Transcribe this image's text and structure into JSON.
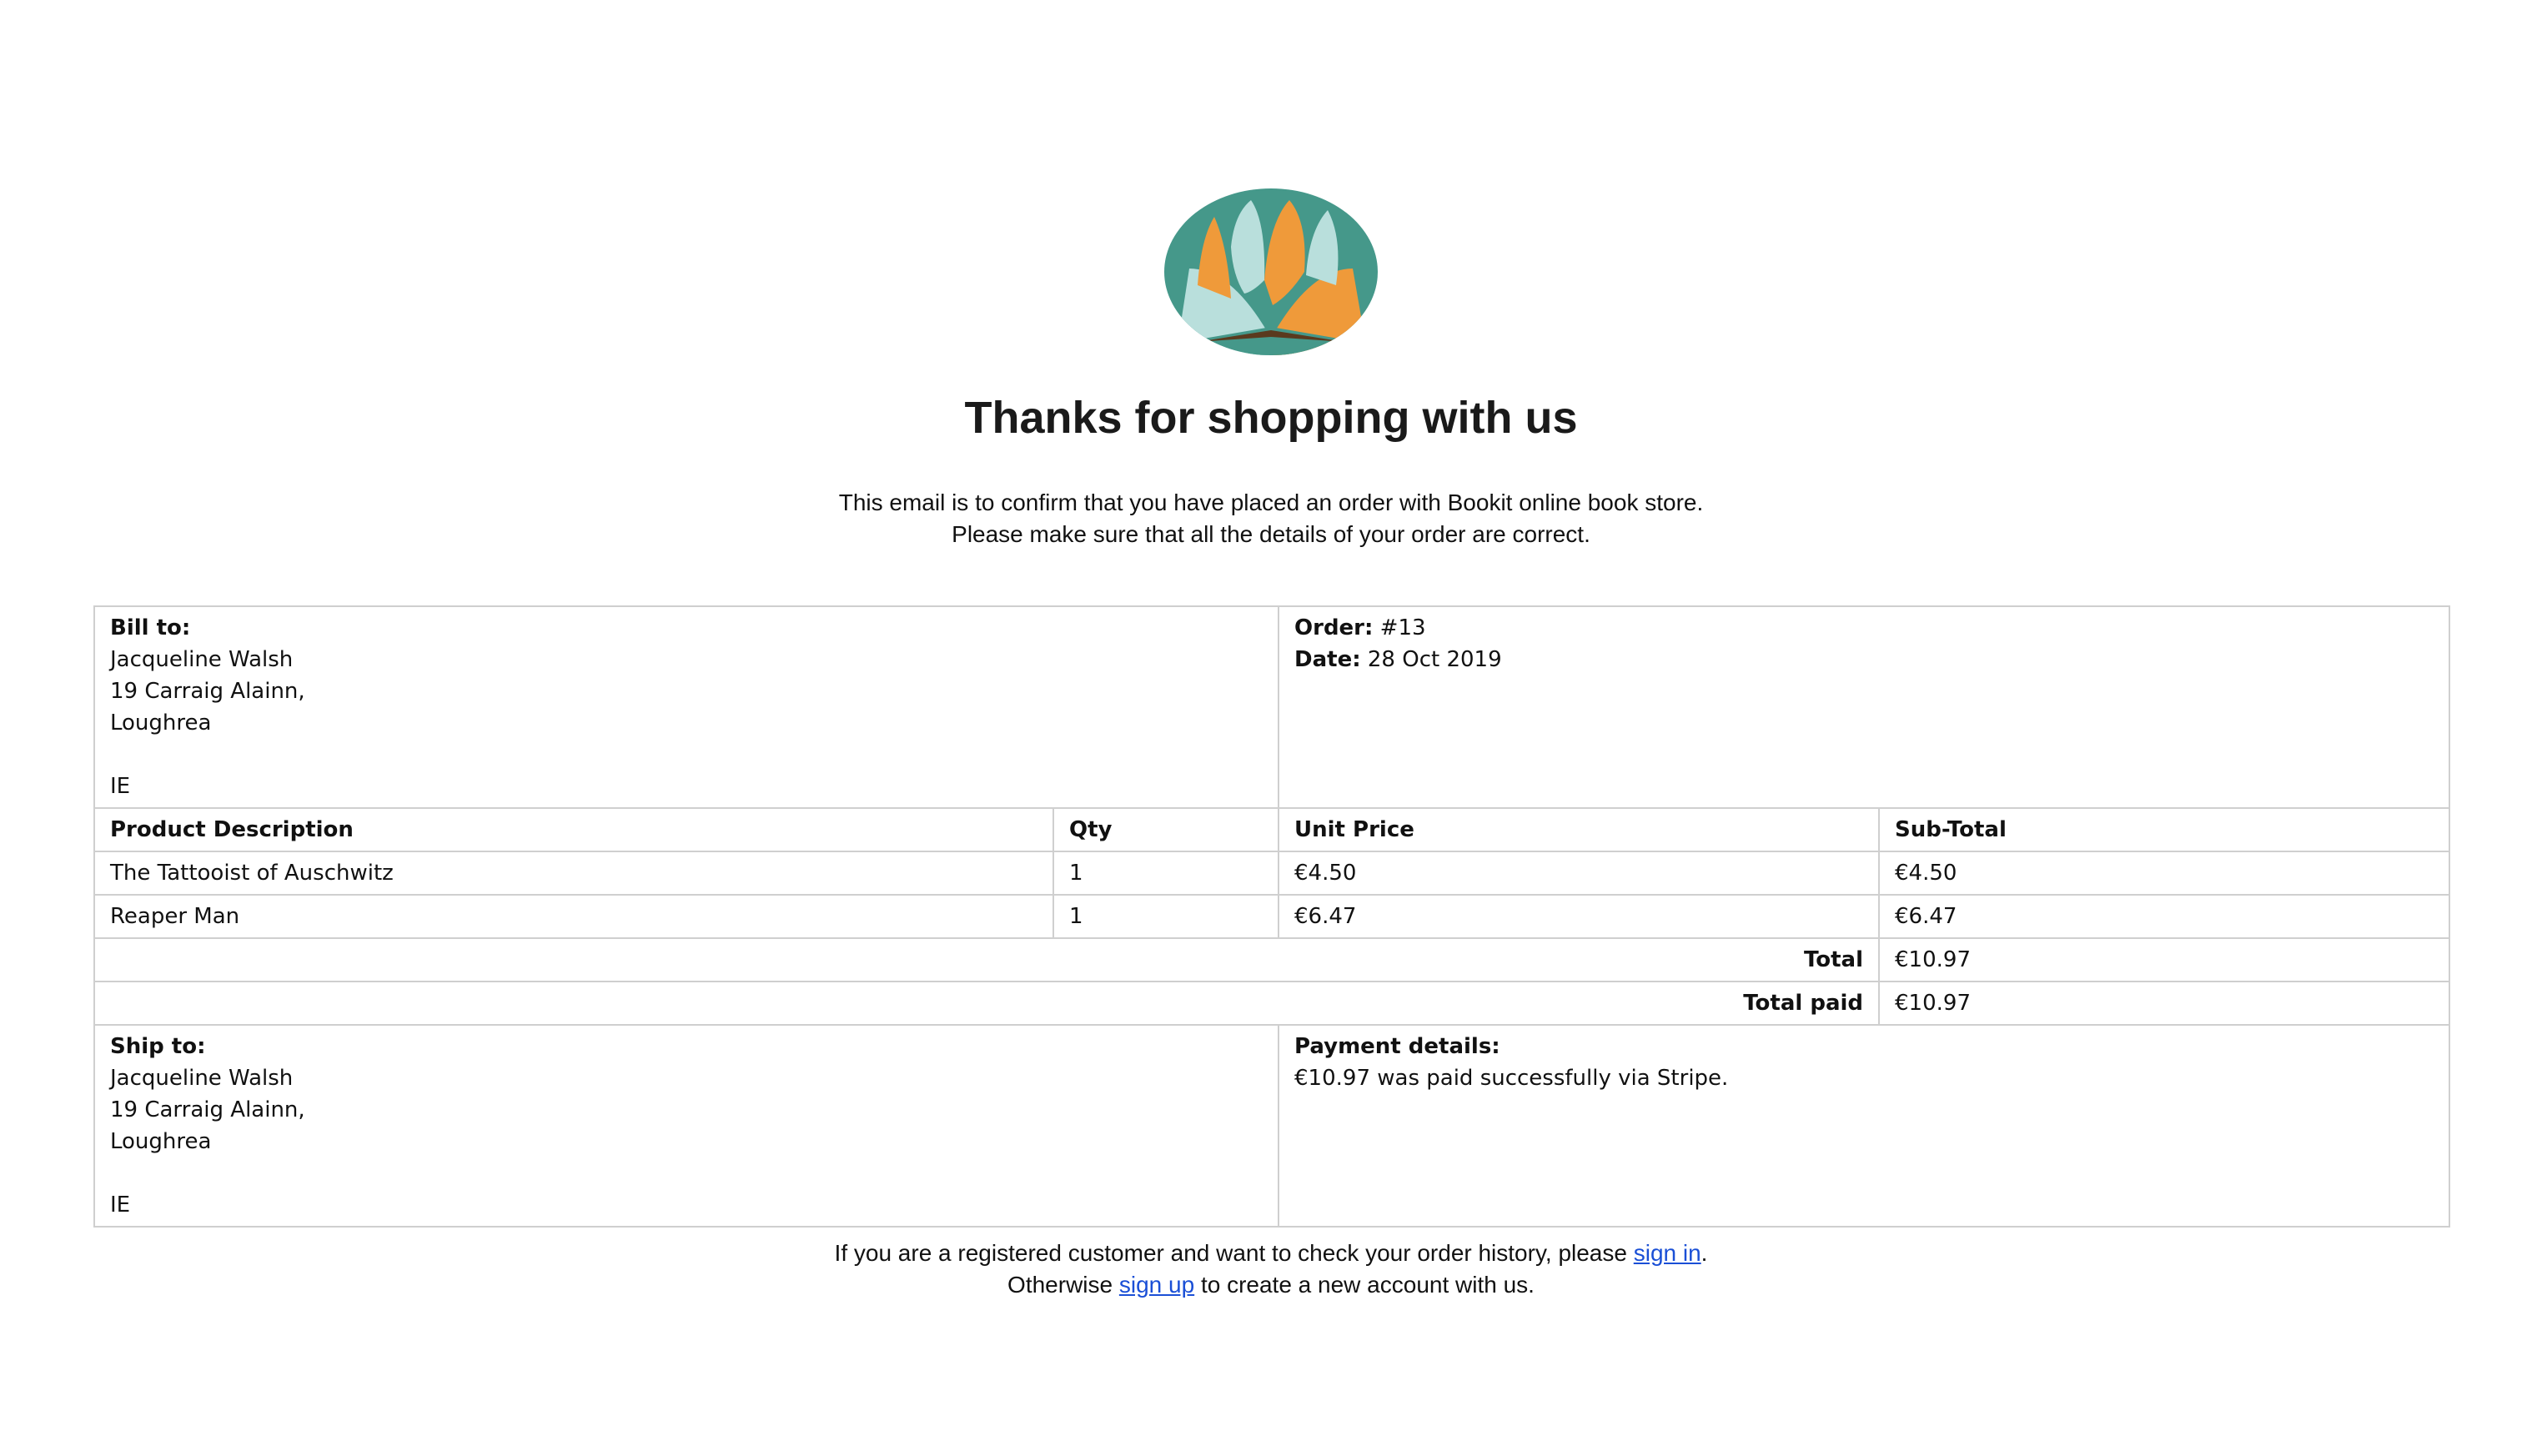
{
  "brand": {
    "colors": {
      "teal": "#45988a",
      "orange": "#ef9a3a",
      "mint": "#b9dfdc",
      "brown": "#5a3a1e"
    }
  },
  "heading": "Thanks for shopping with us",
  "intro": {
    "line1": "This email is to confirm that you have placed an order with Bookit online book store.",
    "line2": "Please make sure that all the details of your order are correct."
  },
  "bill_to": {
    "label": "Bill to:",
    "name": "Jacqueline Walsh",
    "line1": "19 Carraig Alainn,",
    "line2": "Loughrea",
    "country": "IE"
  },
  "order": {
    "order_label": "Order:",
    "order_number": "#13",
    "date_label": "Date:",
    "date": "28 Oct 2019"
  },
  "items_table": {
    "headers": {
      "description": "Product Description",
      "qty": "Qty",
      "unit_price": "Unit Price",
      "subtotal": "Sub-Total"
    },
    "rows": [
      {
        "description": "The Tattooist of Auschwitz",
        "qty": "1",
        "unit_price": "€4.50",
        "subtotal": "€4.50"
      },
      {
        "description": "Reaper Man",
        "qty": "1",
        "unit_price": "€6.47",
        "subtotal": "€6.47"
      }
    ],
    "total_label": "Total",
    "total_value": "€10.97",
    "total_paid_label": "Total paid",
    "total_paid_value": "€10.97"
  },
  "ship_to": {
    "label": "Ship to:",
    "name": "Jacqueline Walsh",
    "line1": "19 Carraig Alainn,",
    "line2": "Loughrea",
    "country": "IE"
  },
  "payment": {
    "label": "Payment details:",
    "text": "€10.97 was paid successfully via Stripe."
  },
  "footer": {
    "line1_before": "If you are a registered customer and want to check your order history, please ",
    "sign_in": "sign in",
    "line1_after": ".",
    "line2_before": "Otherwise ",
    "sign_up": "sign up",
    "line2_after": " to create a new account with us."
  }
}
